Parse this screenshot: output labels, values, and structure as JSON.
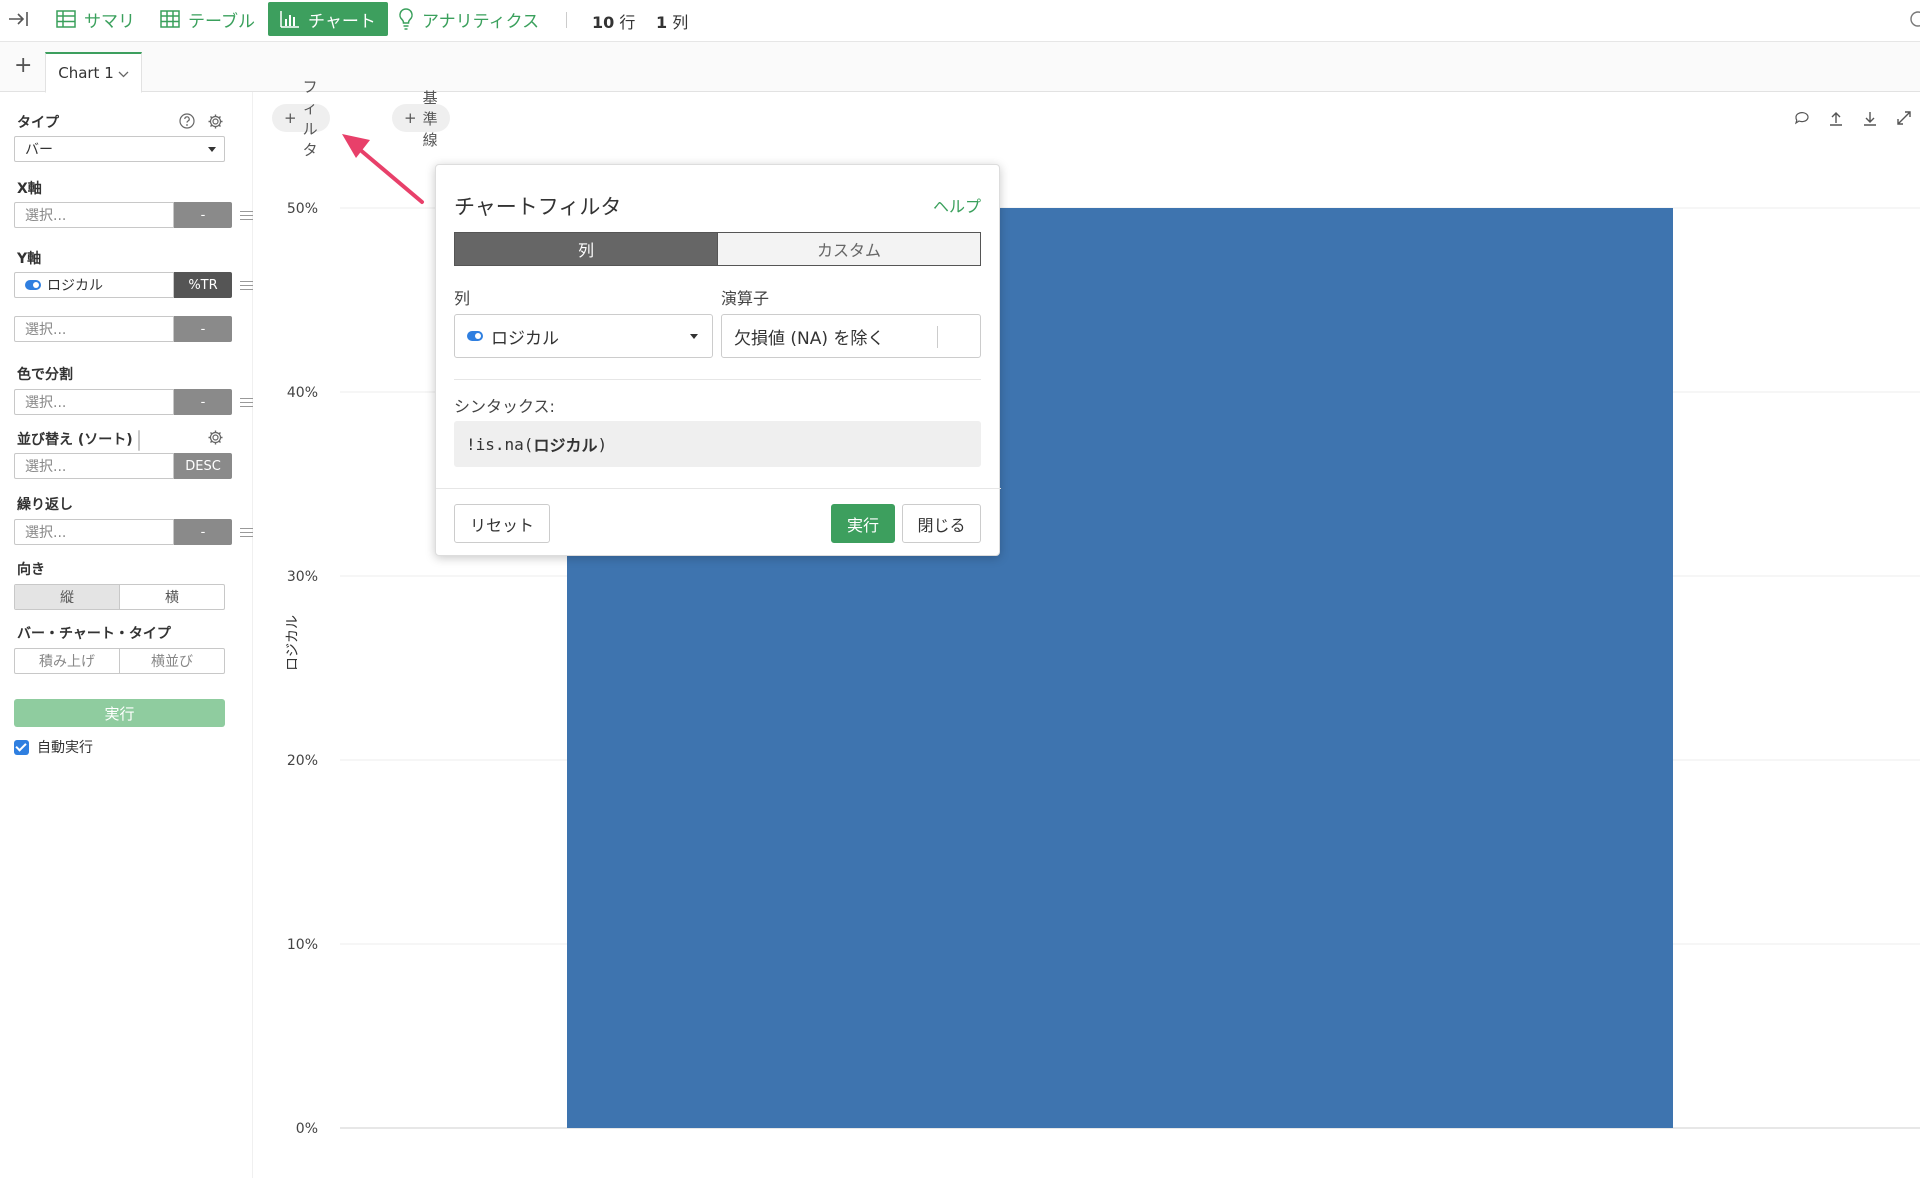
{
  "toolbar": {
    "items": [
      {
        "label": "サマリ",
        "icon": "collapse-sidebar-icon"
      },
      {
        "label": "サマリ",
        "icon": "table-grid-icon"
      },
      {
        "label": "テーブル",
        "icon": "table-grid-icon"
      },
      {
        "label": "チャート",
        "icon": "bar-chart-icon"
      },
      {
        "label": "アナリティクス",
        "icon": "lightbulb-icon"
      }
    ],
    "rows": "10",
    "rows_unit": "行",
    "cols": "1",
    "cols_unit": "列",
    "accent": "#3d9f5e"
  },
  "tabs": {
    "add": "+",
    "chart1": "Chart 1"
  },
  "left_panel": {
    "type_label": "タイプ",
    "type_value": "バー",
    "x_label": "X軸",
    "x_placeholder": "選択...",
    "x_agg": "-",
    "y_label": "Y軸",
    "y_value": "ロジカル",
    "y_agg": "%TR",
    "y2_placeholder": "選択...",
    "y2_agg": "-",
    "color_label": "色で分割",
    "color_placeholder": "選択...",
    "color_agg": "-",
    "sort_label": "並び替え (ソート)",
    "sort_placeholder": "選択...",
    "sort_order": "DESC",
    "repeat_label": "繰り返し",
    "repeat_placeholder": "選択...",
    "repeat_agg": "-",
    "orientation_label": "向き",
    "orientation_options": [
      "縦",
      "横"
    ],
    "bar_type_label": "バー・チャート・タイプ",
    "bar_type_options": [
      "積み上げ",
      "横並び"
    ],
    "run_label": "実行",
    "auto_run_label": "自動実行"
  },
  "chart_toolbar": {
    "filter_label": "フィルタ",
    "reference_line_label": "基準線"
  },
  "chart_data": {
    "type": "bar",
    "categories": [
      ""
    ],
    "values": [
      50
    ],
    "ylabel": "ロジカル",
    "yticks": [
      "0%",
      "10%",
      "20%",
      "30%",
      "40%",
      "50%"
    ],
    "ylim": [
      0,
      50
    ],
    "grid": true,
    "bar_color": "#3e74af"
  },
  "dialog": {
    "title": "チャートフィルタ",
    "help": "ヘルプ",
    "tabs": [
      "列",
      "カスタム"
    ],
    "column_label": "列",
    "column_value": "ロジカル",
    "operator_label": "演算子",
    "operator_value": "欠損値 (NA) を除く",
    "syntax_label": "シンタックス:",
    "syntax_prefix": "!is.na(",
    "syntax_arg": "ロジカル",
    "syntax_suffix": ")",
    "reset": "リセット",
    "run": "実行",
    "close": "閉じる"
  },
  "annotation_color": "#e8406a"
}
